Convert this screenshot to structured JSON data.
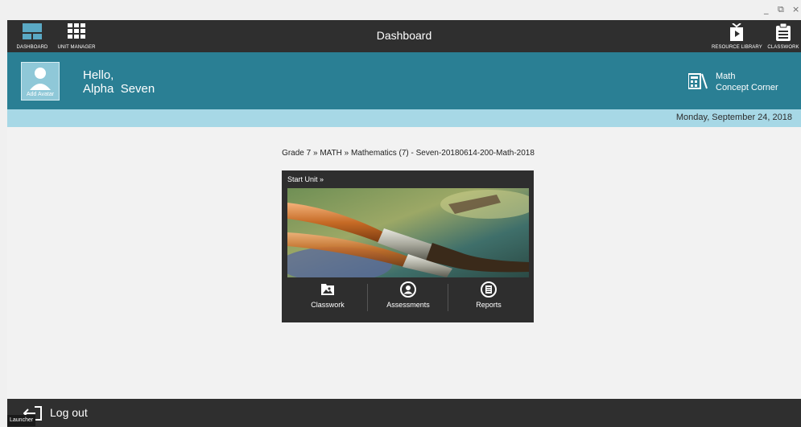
{
  "window": {
    "minimize": "_",
    "restore": "⧉",
    "close": "×"
  },
  "nav": {
    "title": "Dashboard",
    "dashboard_label": "DASHBOARD",
    "unit_manager_label": "UNIT MANAGER",
    "resource_library_label": "RESOURCE LIBRARY",
    "classwork_label": "CLASSWORK"
  },
  "header": {
    "avatar_label": "Add Avatar",
    "greeting": "Hello,",
    "user_name": "Alpha  Seven",
    "concept_line1": "Math",
    "concept_line2": "Concept Corner"
  },
  "date": "Monday, September 24, 2018",
  "breadcrumb": "Grade 7 » MATH » Mathematics (7) - Seven-20180614-200-Math-2018",
  "card": {
    "start_unit": "Start Unit »",
    "actions": [
      {
        "label": "Classwork",
        "icon": "classwork-icon"
      },
      {
        "label": "Assessments",
        "icon": "assessments-icon"
      },
      {
        "label": "Reports",
        "icon": "reports-icon"
      }
    ]
  },
  "footer": {
    "logout": "Log out",
    "launcher": "Launcher"
  },
  "colors": {
    "nav": "#2f2f2f",
    "header": "#2a7f94",
    "datebar": "#a7d8e6",
    "content": "#f2f2f2"
  }
}
